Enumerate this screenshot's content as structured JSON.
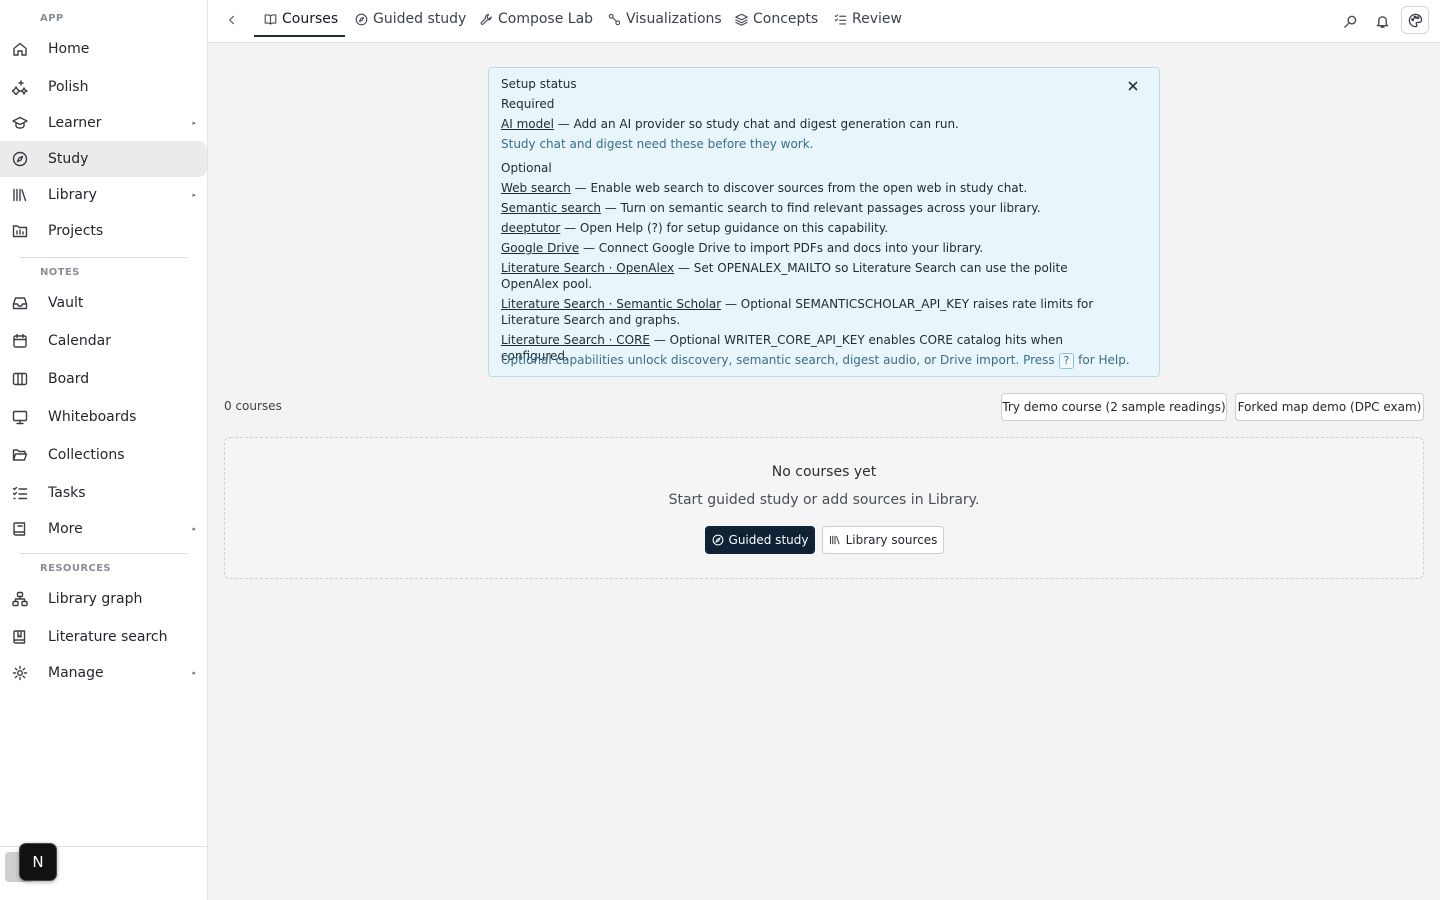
{
  "sidebar": {
    "app_label": "APP",
    "notes_label": "NOTES",
    "resources_label": "RESOURCES",
    "items": {
      "home": "Home",
      "polish": "Polish",
      "learner": "Learner",
      "study": "Study",
      "library": "Library",
      "projects": "Projects",
      "vault": "Vault",
      "calendar": "Calendar",
      "board": "Board",
      "whiteboards": "Whiteboards",
      "collections": "Collections",
      "tasks": "Tasks",
      "more": "More",
      "library_graph": "Library graph",
      "literature_search": "Literature search",
      "manage": "Manage"
    },
    "active": "Study",
    "caret": "▸",
    "badge": "N"
  },
  "tabs": {
    "courses": "Courses",
    "guided_study": "Guided study",
    "compose_lab": "Compose Lab",
    "visualizations": "Visualizations",
    "concepts": "Concepts",
    "review": "Review"
  },
  "setup": {
    "title": "Setup status",
    "required_label": "Required",
    "ai_model_link": "AI model",
    "ai_model_desc": " — Add an AI provider so study chat and digest generation can run.",
    "required_note": "Study chat and digest need these before they work.",
    "optional_label": "Optional",
    "web_search_link": "Web search",
    "web_search_desc": " — Enable web search to discover sources from the open web in study chat.",
    "semantic_link": "Semantic search",
    "semantic_desc": " — Turn on semantic search to find relevant passages across your library.",
    "deeptutor_link": "deeptutor",
    "deeptutor_desc": " — Open Help (?) for setup guidance on this capability.",
    "gdrive_link": "Google Drive",
    "gdrive_desc": " — Connect Google Drive to import PDFs and docs into your library.",
    "openalex_link": "Literature Search · OpenAlex",
    "openalex_desc": " — Set OPENALEX_MAILTO so Literature Search can use the polite OpenAlex pool.",
    "s2_link": "Literature Search · Semantic Scholar",
    "s2_desc": " — Optional SEMANTICSCHOLAR_API_KEY raises rate limits for Literature Search and graphs.",
    "core_link": "Literature Search · CORE",
    "core_desc": " — Optional WRITER_CORE_API_KEY enables CORE catalog hits when configured.",
    "footer_pre": "Optional capabilities unlock discovery, semantic search, digest audio, or Drive import. Press ",
    "footer_key": "?",
    "footer_post": " for Help."
  },
  "courses": {
    "count": "0 courses",
    "demo_button": "Try demo course (2 sample readings)",
    "forked_button": "Forked map demo (DPC exam)",
    "empty_title": "No courses yet",
    "empty_sub": "Start guided study or add sources in Library.",
    "guided_button": "Guided study",
    "library_button": "Library sources"
  }
}
